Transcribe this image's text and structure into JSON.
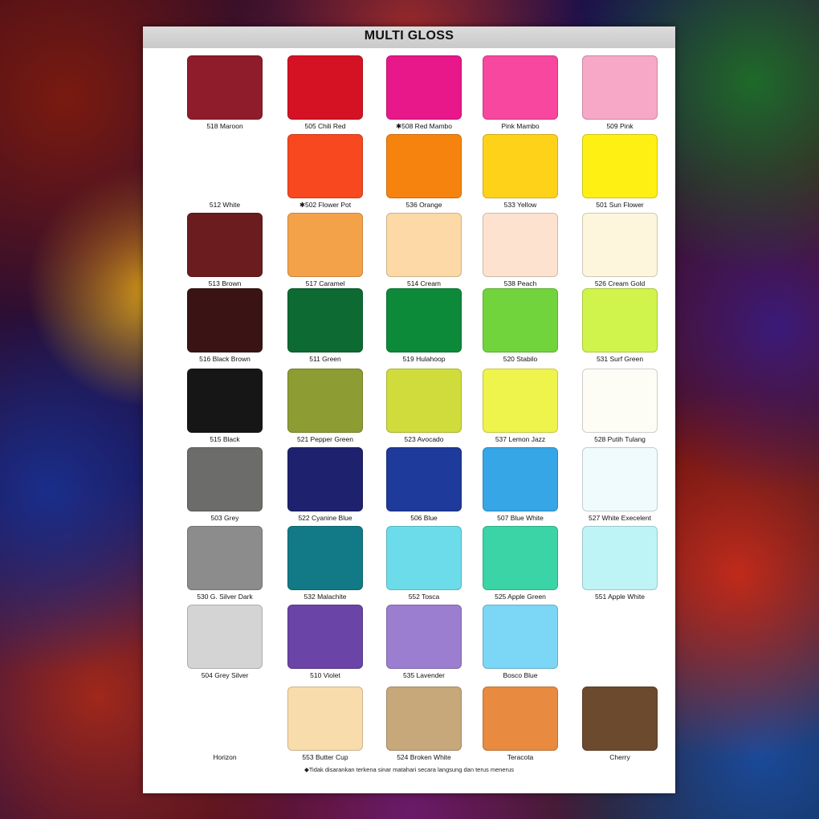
{
  "page": {
    "title": "MULTI GLOSS",
    "footnote": "◆Tidak disarankan terkena sinar matahari secara langsung dan terus menerus"
  },
  "swatches": [
    [
      {
        "code": "518",
        "name": "Maroon",
        "label": "518  Maroon",
        "color": "#8e1c2b"
      },
      {
        "code": "505",
        "name": "Chili Red",
        "label": "505  Chili Red",
        "color": "#d41224"
      },
      {
        "code": "508",
        "name": "Red Mambo",
        "label": "✱508  Red Mambo",
        "color": "#e8178a"
      },
      {
        "code": "",
        "name": "Pink Mambo",
        "label": "Pink Mambo",
        "color": "#f7479e"
      },
      {
        "code": "509",
        "name": "Pink",
        "label": "509   Pink",
        "color": "#f6a8c6"
      }
    ],
    [
      {
        "code": "512",
        "name": "White",
        "label": "512    White",
        "color": "#ffffff"
      },
      {
        "code": "502",
        "name": "Flower Pot",
        "label": "✱502  Flower Pot",
        "color": "#f7481f"
      },
      {
        "code": "536",
        "name": "Orange",
        "label": "536  Orange",
        "color": "#f7830f"
      },
      {
        "code": "533",
        "name": "Yellow",
        "label": "533 Yellow",
        "color": "#ffd21a"
      },
      {
        "code": "501",
        "name": "Sun Flower",
        "label": "501 Sun Flower",
        "color": "#fff014"
      }
    ],
    [
      {
        "code": "513",
        "name": "Brown",
        "label": "513    Brown",
        "color": "#6a1c1e"
      },
      {
        "code": "517",
        "name": "Caramel",
        "label": "517   Caramel",
        "color": "#f4a24a"
      },
      {
        "code": "514",
        "name": "Cream",
        "label": "514   Cream",
        "color": "#fcd9a6"
      },
      {
        "code": "538",
        "name": "Peach",
        "label": "538 Peach",
        "color": "#fde2d0"
      },
      {
        "code": "526",
        "name": "Cream Gold",
        "label": "526   Cream Gold",
        "color": "#fdf6dc"
      }
    ],
    [
      {
        "code": "516",
        "name": "Black Brown",
        "label": "516  Black Brown",
        "color": "#3a1414"
      },
      {
        "code": "511",
        "name": "Green",
        "label": "511     Green",
        "color": "#0d6a32"
      },
      {
        "code": "519",
        "name": "Hulahoop",
        "label": "519  Hulahoop",
        "color": "#0c8a3a"
      },
      {
        "code": "520",
        "name": "Stabilo",
        "label": "520  Stabilo",
        "color": "#72d43c"
      },
      {
        "code": "531",
        "name": "Surf Green",
        "label": "531 Surf Green",
        "color": "#d0f44c"
      }
    ],
    [
      {
        "code": "515",
        "name": "Black",
        "label": "515    Black",
        "color": "#161616"
      },
      {
        "code": "521",
        "name": "Pepper Green",
        "label": "521  Pepper Green",
        "color": "#8e9c34"
      },
      {
        "code": "523",
        "name": "Avocado",
        "label": "523   Avocado",
        "color": "#cfdc3c"
      },
      {
        "code": "537",
        "name": "Lemon Jazz",
        "label": "537 Lemon Jazz",
        "color": "#eef44c"
      },
      {
        "code": "528",
        "name": "Putih Tulang",
        "label": "528 Putih Tulang",
        "color": "#fdfdf6"
      }
    ],
    [
      {
        "code": "503",
        "name": "Grey",
        "label": "503     Grey",
        "color": "#6c6c6a"
      },
      {
        "code": "522",
        "name": "Cyanine Blue",
        "label": "522 Cyanine Blue",
        "color": "#1e226e"
      },
      {
        "code": "506",
        "name": "Blue",
        "label": "506      Blue",
        "color": "#1e3a9a"
      },
      {
        "code": "507",
        "name": "Blue White",
        "label": "507  Blue White",
        "color": "#36a6e6"
      },
      {
        "code": "527",
        "name": "White Execelent",
        "label": "527 White Execelent",
        "color": "#f0fbfd"
      }
    ],
    [
      {
        "code": "530",
        "name": "G. Silver Dark",
        "label": "530  G. Silver Dark",
        "color": "#8c8c8c"
      },
      {
        "code": "532",
        "name": "Malachite",
        "label": "532 Malachite",
        "color": "#117a86"
      },
      {
        "code": "552",
        "name": "Tosca",
        "label": "552   Tosca",
        "color": "#6cdcea"
      },
      {
        "code": "525",
        "name": "Apple Green",
        "label": "525 Apple Green",
        "color": "#3ad4a6"
      },
      {
        "code": "551",
        "name": "Apple White",
        "label": "551 Apple White",
        "color": "#bef4f6"
      }
    ],
    [
      {
        "code": "504",
        "name": "Grey Silver",
        "label": "504 Grey Silver",
        "color": "#d4d4d4"
      },
      {
        "code": "510",
        "name": "Violet",
        "label": "510    Violet",
        "color": "#6a44a6"
      },
      {
        "code": "535",
        "name": "Lavender",
        "label": "535  Lavender",
        "color": "#9c7ed0"
      },
      {
        "code": "",
        "name": "Bosco Blue",
        "label": "Bosco Blue",
        "color": "#7cd6f6"
      },
      null
    ],
    [
      {
        "code": "",
        "name": "Horizon",
        "label": "Horizon",
        "color": "#ffffff"
      },
      {
        "code": "553",
        "name": "Butter Cup",
        "label": "553  Butter Cup",
        "color": "#f9dcac"
      },
      {
        "code": "524",
        "name": "Broken White",
        "label": "524  Broken White",
        "color": "#c6a87a"
      },
      {
        "code": "",
        "name": "Teracota",
        "label": "Teracota",
        "color": "#e88a40"
      },
      {
        "code": "",
        "name": "Cherry",
        "label": "Cherry",
        "color": "#6c4a2e"
      }
    ]
  ]
}
